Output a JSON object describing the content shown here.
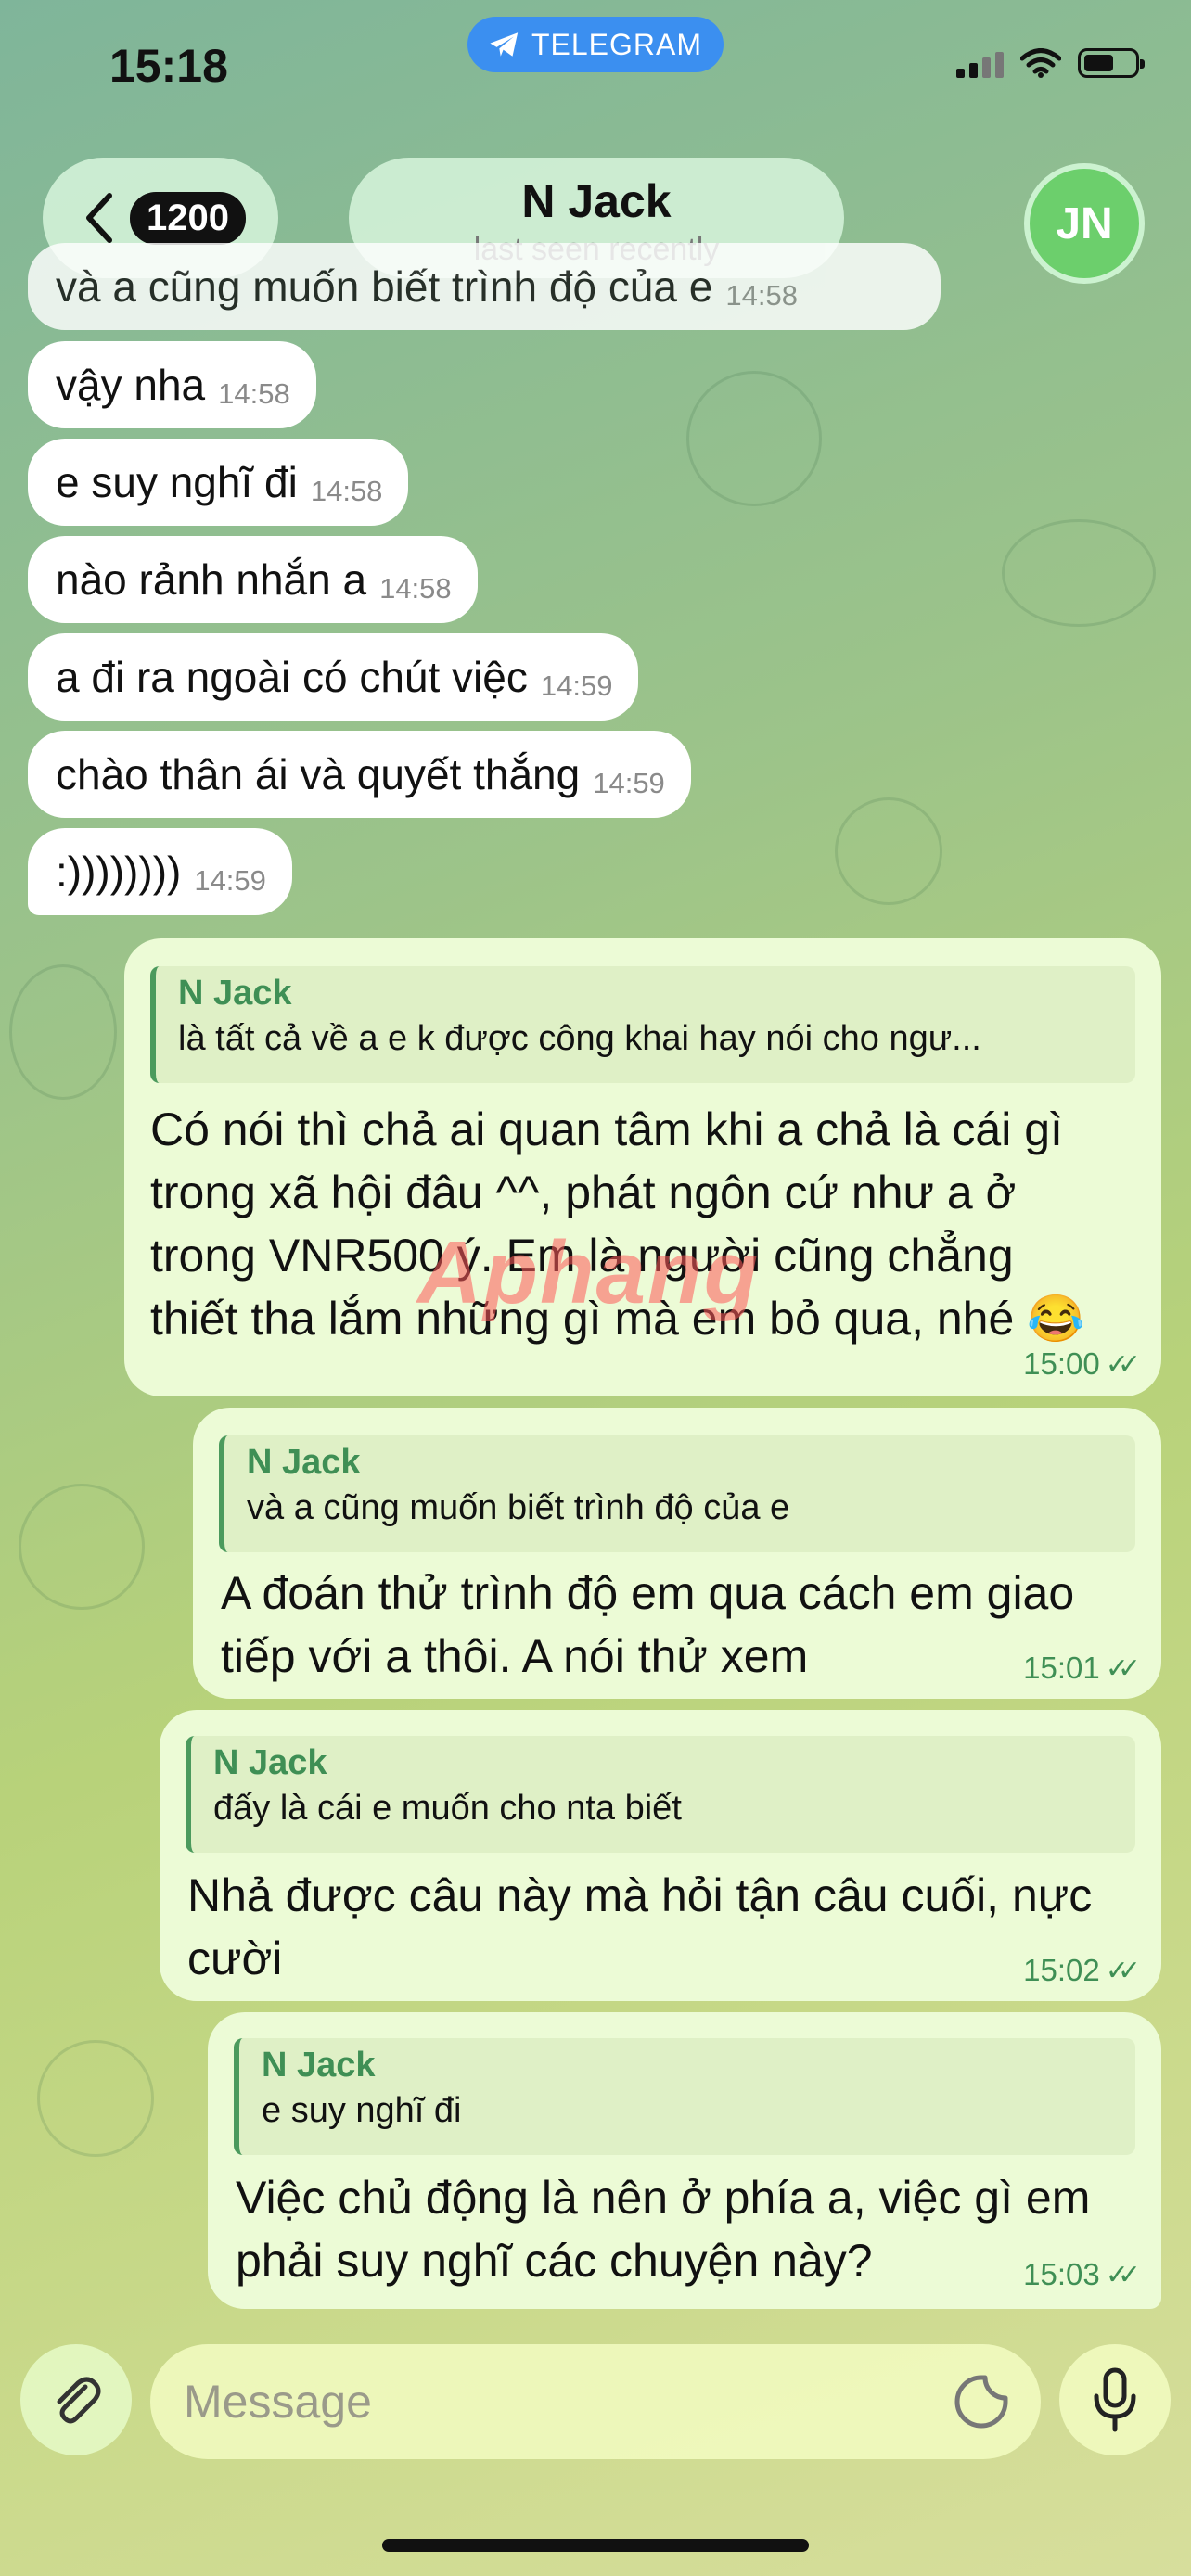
{
  "status_bar": {
    "time": "15:18",
    "pill_label": "TELEGRAM"
  },
  "header": {
    "unread_count": "1200",
    "contact_name": "N Jack",
    "status": "last seen recently",
    "avatar_initials": "JN"
  },
  "incoming": [
    {
      "text": "và a cũng muốn biết trình độ của e",
      "time": "14:58"
    },
    {
      "text": "vậy nha",
      "time": "14:58"
    },
    {
      "text": "e suy nghĩ đi",
      "time": "14:58"
    },
    {
      "text": "nào rảnh nhắn a",
      "time": "14:58"
    },
    {
      "text": "a đi ra ngoài có chút việc",
      "time": "14:59"
    },
    {
      "text": "chào thân ái và quyết thắng",
      "time": "14:59"
    },
    {
      "text": ":))))))))",
      "time": "14:59"
    }
  ],
  "outgoing": [
    {
      "reply_name": "N Jack",
      "reply_text": "là tất cả về a e k được công khai hay nói cho ngư...",
      "lines": [
        "Có nói thì chả ai quan tâm khi a chả là cái gì",
        "trong xã hội đâu ^^, phát ngôn cứ như a ở",
        "trong VNR500 ý. Em là người cũng chẳng",
        "thiết tha lắm những gì mà em bỏ qua, nhé 😂"
      ],
      "time": "15:00"
    },
    {
      "reply_name": "N Jack",
      "reply_text": "và a cũng muốn biết trình độ của e",
      "lines": [
        "A đoán thử trình độ em qua cách em giao",
        "tiếp với a thôi. A nói thử xem"
      ],
      "time": "15:01"
    },
    {
      "reply_name": "N Jack",
      "reply_text": "đấy là cái e muốn cho nta biết",
      "lines": [
        "Nhả được câu này mà hỏi tận câu cuối, nực",
        "cười"
      ],
      "time": "15:02"
    },
    {
      "reply_name": "N Jack",
      "reply_text": "e suy nghĩ đi",
      "lines": [
        "Việc chủ động là nên ở phía a, việc gì em",
        "phải suy nghĩ các chuyện này?"
      ],
      "time": "15:03"
    }
  ],
  "composer": {
    "placeholder": "Message"
  },
  "watermark": "Aphang",
  "colors": {
    "pill": "#3b8ff0",
    "outgoing_bubble": "#ecfbd6",
    "accent_green": "#3f8f55",
    "avatar": "#6ccf6c"
  },
  "icons": [
    "telegram-plane-icon",
    "signal-icon",
    "wifi-icon",
    "battery-icon",
    "back-chevron-icon",
    "paperclip-icon",
    "sticker-icon",
    "microphone-icon",
    "double-check-icon"
  ]
}
